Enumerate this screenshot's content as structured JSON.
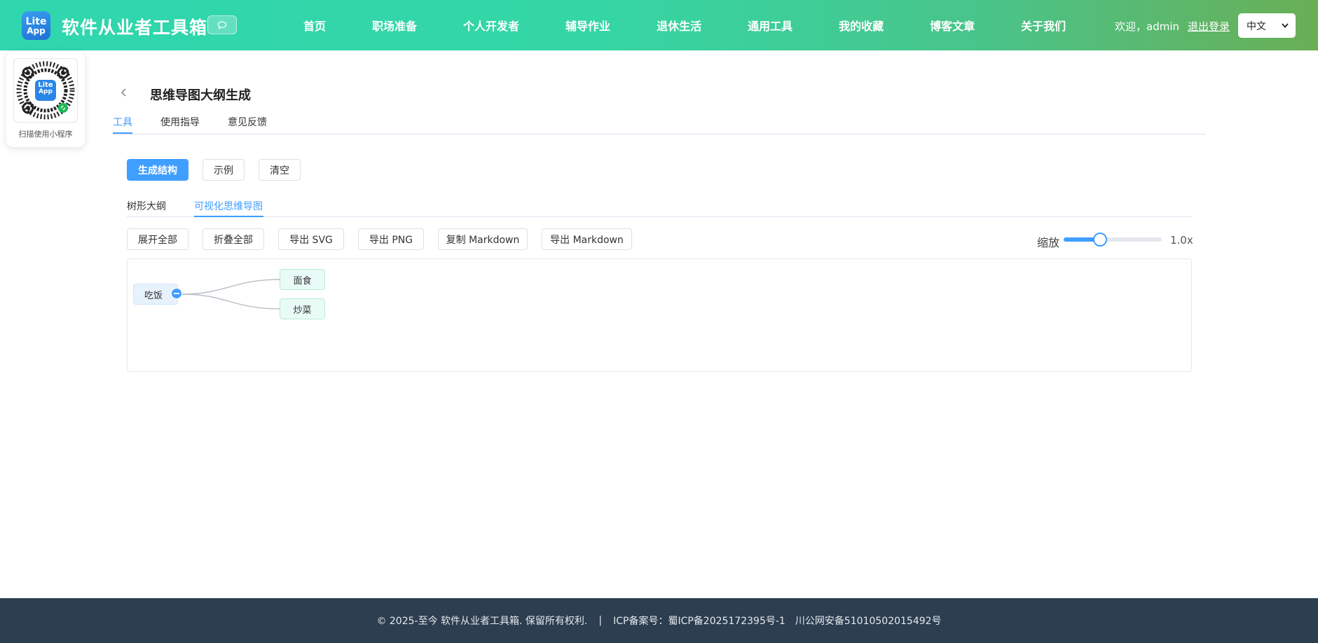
{
  "header": {
    "logo_line1": "Lite",
    "logo_line2": "App",
    "site_title": "软件从业者工具箱",
    "nav": [
      "首页",
      "职场准备",
      "个人开发者",
      "辅导作业",
      "退休生活",
      "通用工具",
      "我的收藏",
      "博客文章",
      "关于我们"
    ],
    "welcome": "欢迎，admin",
    "logout": "退出登录",
    "language": "中文"
  },
  "qr": {
    "caption": "扫描使用小程序",
    "logo_line1": "Lite",
    "logo_line2": "App"
  },
  "page": {
    "title": "思维导图大纲生成",
    "tabs": [
      "工具",
      "使用指导",
      "意见反馈"
    ],
    "active_tab": "工具"
  },
  "actions": {
    "generate": "生成结构",
    "example": "示例",
    "clear": "清空"
  },
  "view_tabs": [
    "树形大纲",
    "可视化思维导图"
  ],
  "active_view": "可视化思维导图",
  "toolbar": {
    "expand_all": "展开全部",
    "collapse_all": "折叠全部",
    "export_svg": "导出 SVG",
    "export_png": "导出 PNG",
    "copy_md": "复制 Markdown",
    "export_md": "导出 Markdown",
    "zoom_label": "缩放",
    "zoom_value": "1.0x",
    "zoom_fraction": 0.37
  },
  "mindmap": {
    "root": "吃饭",
    "children": [
      "面食",
      "炒菜"
    ]
  },
  "footer": {
    "copyright": "© 2025-至今 软件从业者工具箱. 保留所有权利.",
    "separator": "|",
    "icp": "ICP备案号：蜀ICP备2025172395号-1",
    "police": "川公网安备51010502015492号"
  },
  "colors": {
    "primary": "#409eff",
    "header_start": "#2fd6ae",
    "header_end": "#6aae55",
    "footer_bg": "#2c3e50"
  }
}
